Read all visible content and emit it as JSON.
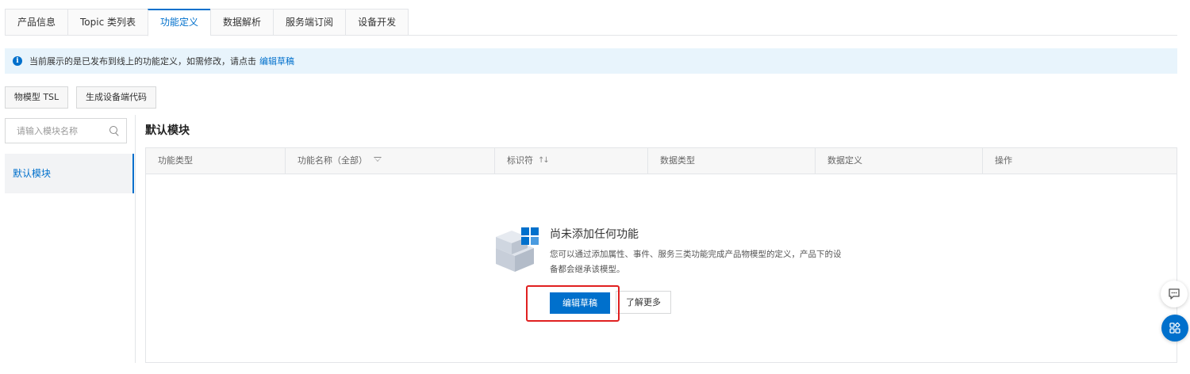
{
  "tabs": [
    {
      "label": "产品信息"
    },
    {
      "label": "Topic 类列表"
    },
    {
      "label": "功能定义"
    },
    {
      "label": "数据解析"
    },
    {
      "label": "服务端订阅"
    },
    {
      "label": "设备开发"
    }
  ],
  "active_tab": "功能定义",
  "notice": {
    "text": "当前展示的是已发布到线上的功能定义，如需修改，请点击",
    "link": "编辑草稿"
  },
  "toolbar": {
    "tsl_label": "物模型 TSL",
    "gen_code_label": "生成设备端代码"
  },
  "sidebar": {
    "search_placeholder": "请输入模块名称",
    "modules": [
      {
        "label": "默认模块"
      }
    ]
  },
  "main": {
    "module_title": "默认模块",
    "columns": [
      {
        "label": "功能类型"
      },
      {
        "label": "功能名称（全部）"
      },
      {
        "label": "标识符"
      },
      {
        "label": "数据类型"
      },
      {
        "label": "数据定义"
      },
      {
        "label": "操作"
      }
    ],
    "empty": {
      "title": "尚未添加任何功能",
      "desc": "您可以通过添加属性、事件、服务三类功能完成产品物模型的定义，产品下的设备都会继承该模型。",
      "primary_label": "编辑草稿",
      "secondary_label": "了解更多"
    }
  },
  "colors": {
    "accent": "#0070cc",
    "highlight": "#e02020",
    "notice_bg": "#e8f4fc"
  },
  "icons": {
    "notice": "info-icon",
    "search": "search-icon",
    "filter": "filter-icon",
    "sort": "sort-icon",
    "chat": "chat-icon",
    "apps": "apps-icon"
  }
}
